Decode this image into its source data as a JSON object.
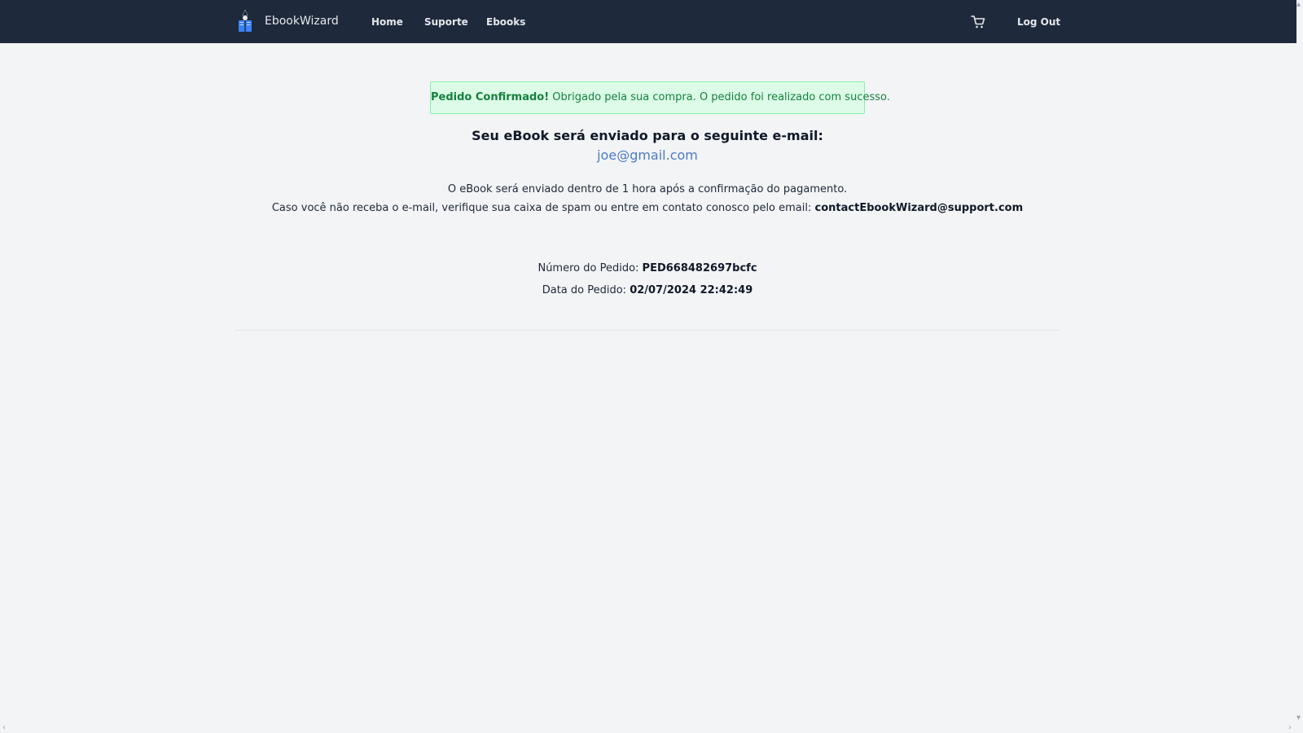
{
  "navbar": {
    "brand_name": "EbookWizard",
    "links": [
      {
        "label": "Home"
      },
      {
        "label": "Suporte"
      },
      {
        "label": "Ebooks"
      }
    ],
    "cart_icon": "cart-icon",
    "logout_label": "Log Out"
  },
  "alert": {
    "title": "Pedido Confirmado!",
    "message": "Obrigado pela sua compra. O pedido foi realizado com sucesso."
  },
  "confirmation": {
    "heading": "Seu eBook será enviado para o seguinte e-mail:",
    "email": "joe@gmail.com",
    "delivery_note": "O eBook será enviado dentro de 1 hora após a confirmação do pagamento.",
    "spam_note": "Caso você não receba o e-mail, verifique sua caixa de spam ou entre em contato conosco pelo email:",
    "support_email": "contactEbookWizard@support.com"
  },
  "order": {
    "number_label": "Número do Pedido:",
    "number_value": "PED668482697bcfc",
    "date_label": "Data do Pedido:",
    "date_value": "02/07/2024 22:42:49"
  },
  "colors": {
    "navbar_bg": "#1e293b",
    "page_bg": "#f3f4f6",
    "alert_bg": "#dcfce7",
    "alert_border": "#86efac",
    "alert_text": "#15803d",
    "email_link": "#4b7cc6"
  }
}
